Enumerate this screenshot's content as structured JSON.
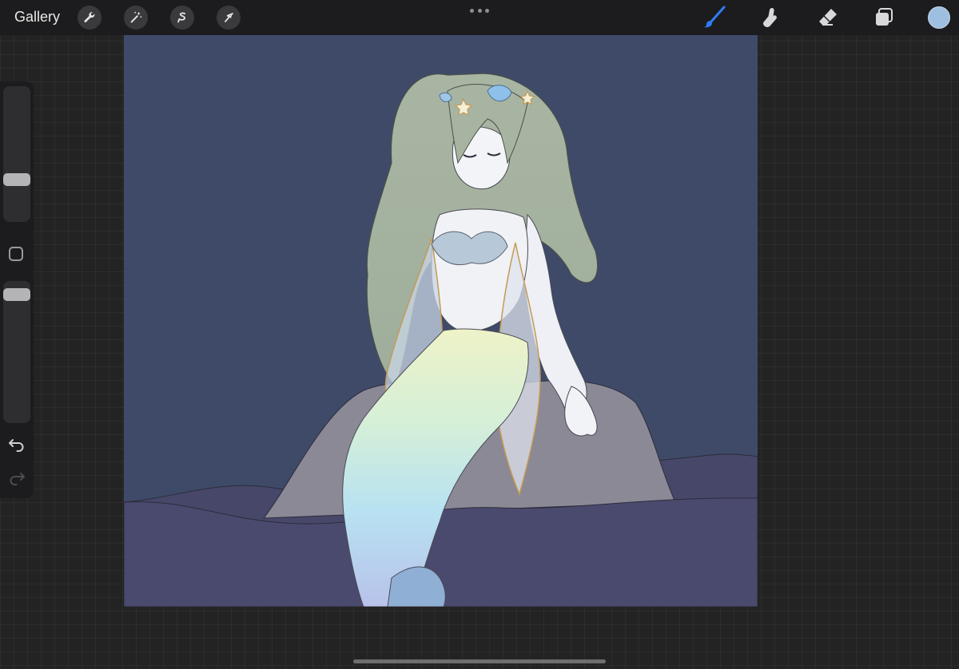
{
  "toolbar": {
    "gallery_label": "Gallery",
    "left_tools": [
      "wrench-icon",
      "magic-wand-icon",
      "selection-icon",
      "transform-arrow-icon"
    ],
    "right_tools": [
      "brush-icon",
      "smudge-icon",
      "eraser-icon",
      "layers-icon"
    ],
    "active_tool": "brush",
    "accent_color": "#2f7bf6",
    "current_color": "#9fbfe0"
  },
  "sidebar": {
    "brush_size_level": 0.62,
    "opacity_level": 0.93,
    "buttons": [
      "modify-square-icon",
      "undo-icon",
      "redo-icon"
    ]
  },
  "canvas": {
    "background_color": "#3e4a68",
    "sea_color": "#4a4a6e",
    "rock_color": "#8c8a96"
  }
}
